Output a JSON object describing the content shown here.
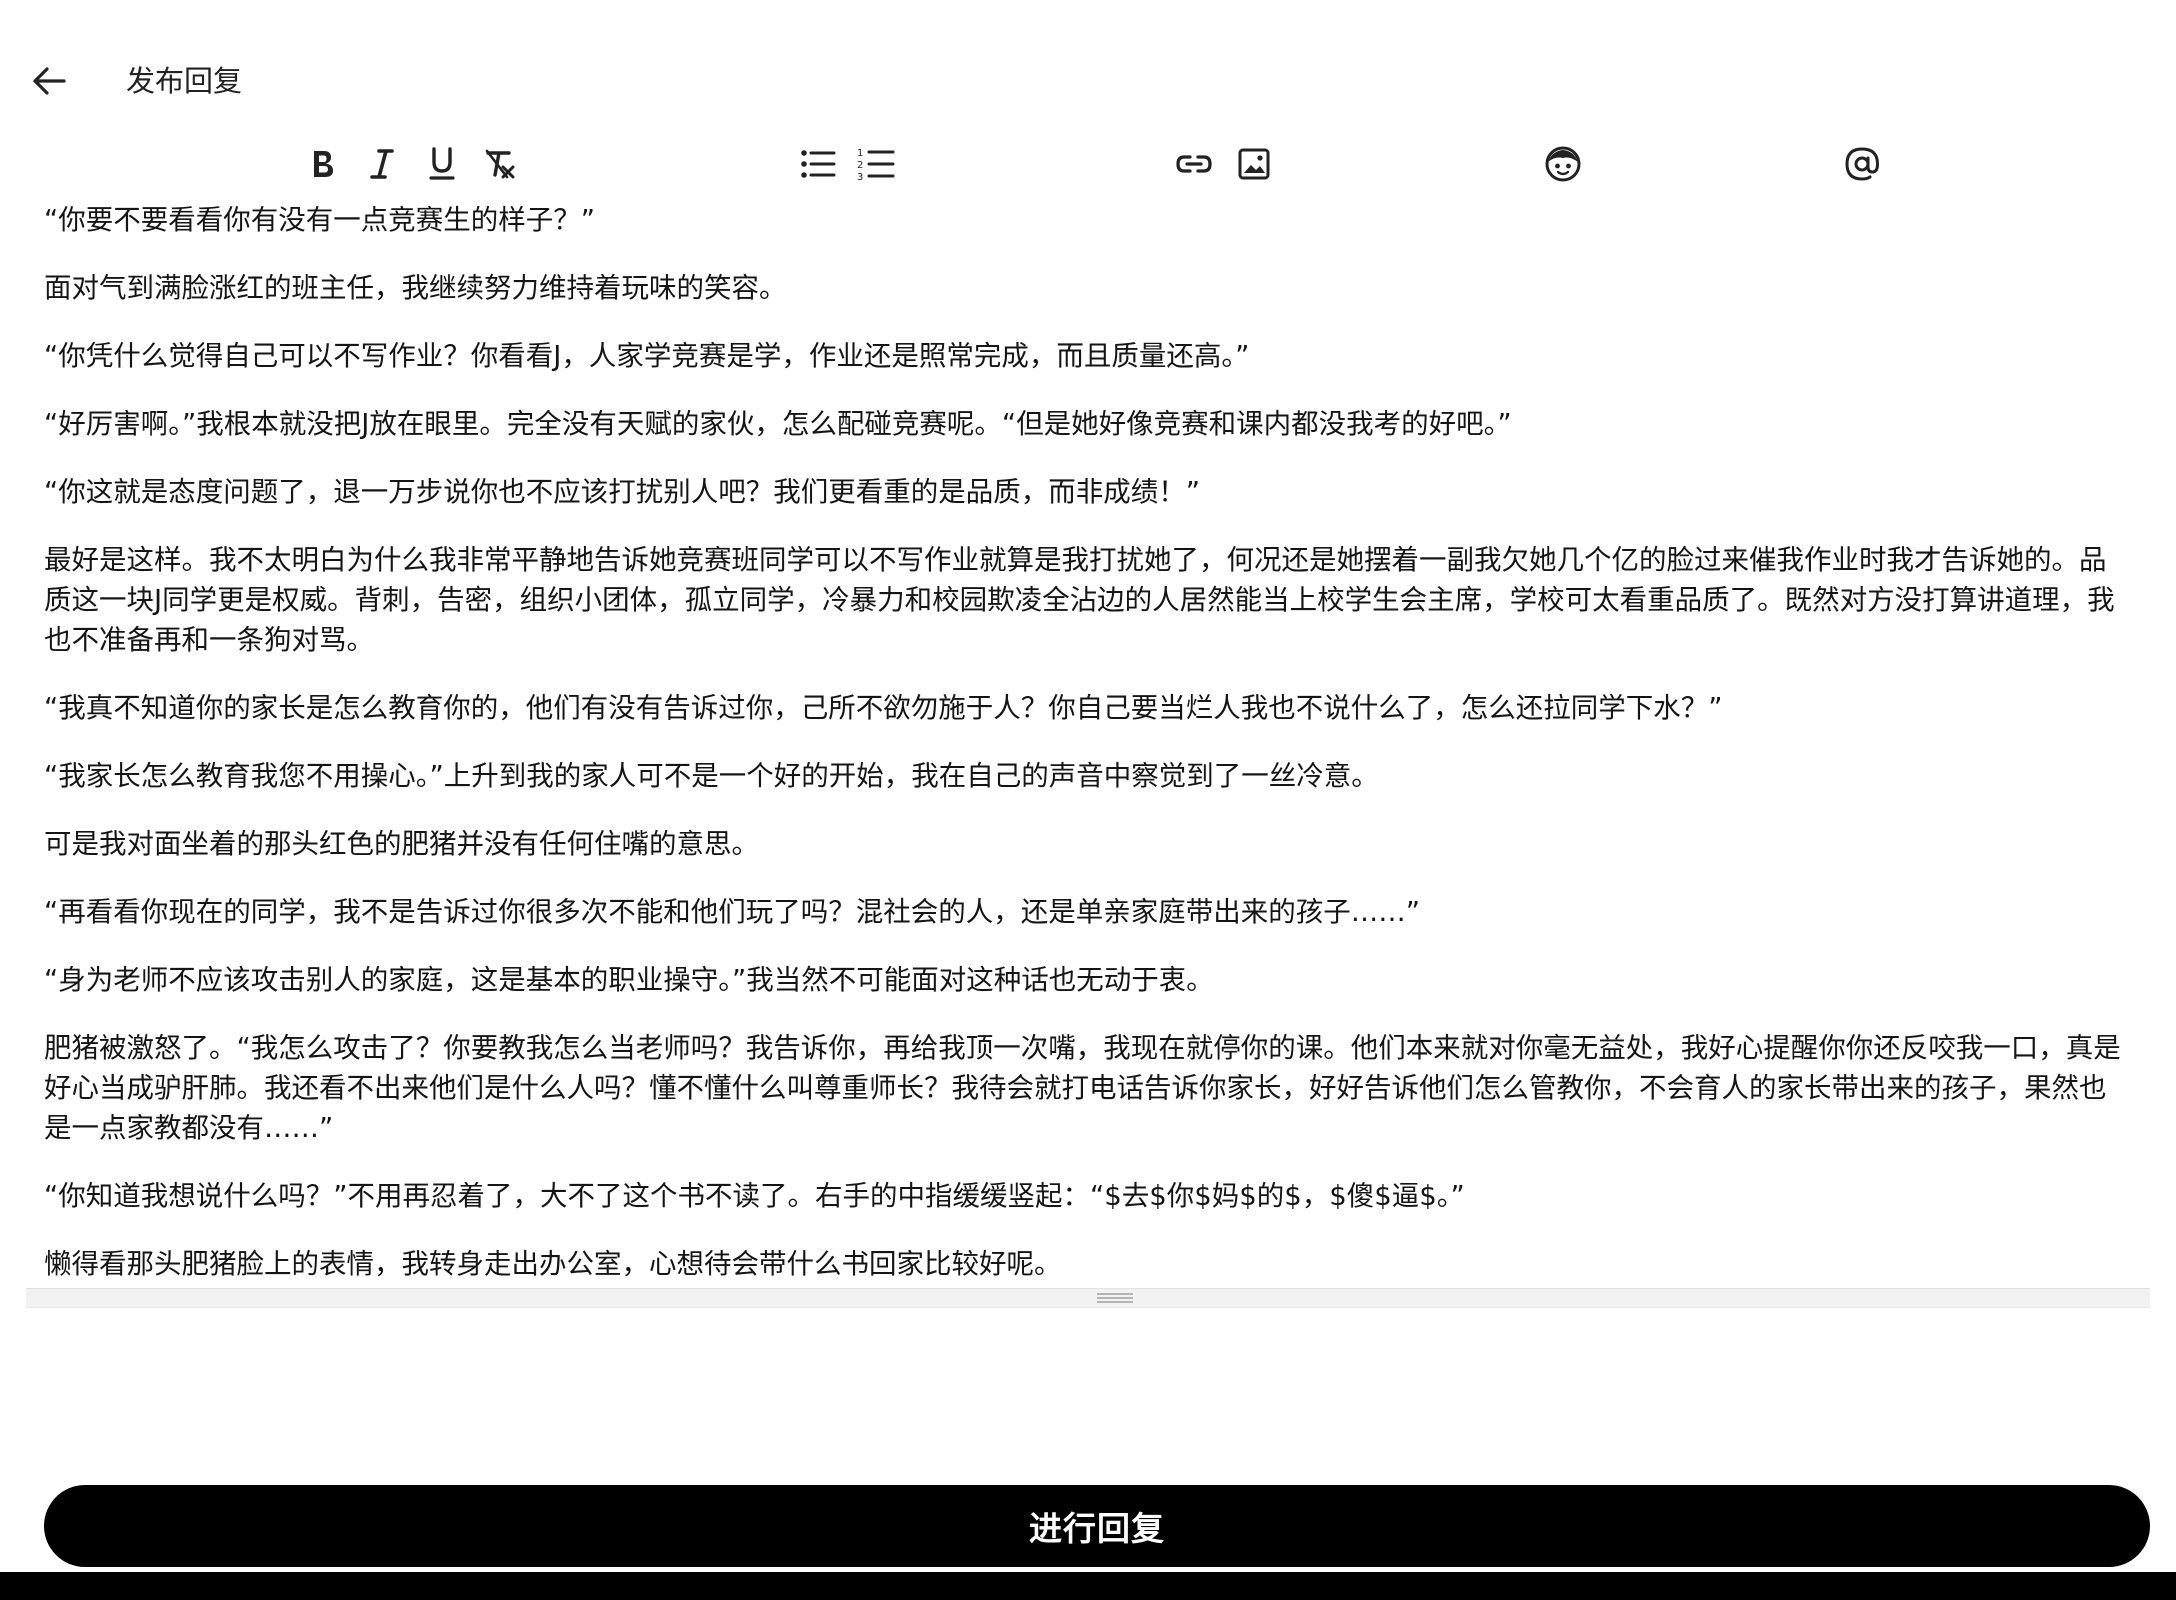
{
  "header": {
    "title": "发布回复",
    "back_icon": "arrow-left-icon"
  },
  "toolbar": {
    "items": [
      {
        "name": "bold",
        "icon": "bold-icon"
      },
      {
        "name": "italic",
        "icon": "italic-icon"
      },
      {
        "name": "underline",
        "icon": "underline-icon"
      },
      {
        "name": "clear-format",
        "icon": "clear-format-icon"
      },
      {
        "name": "bullet-list",
        "icon": "bullet-list-icon"
      },
      {
        "name": "numbered-list",
        "icon": "numbered-list-icon"
      },
      {
        "name": "link",
        "icon": "link-icon"
      },
      {
        "name": "image",
        "icon": "image-icon"
      },
      {
        "name": "emoji",
        "icon": "emoji-icon"
      },
      {
        "name": "mention",
        "icon": "at-sign-icon"
      }
    ]
  },
  "editor": {
    "paragraphs": [
      "“你要不要看看你有没有一点竞赛生的样子？”",
      "面对气到满脸涨红的班主任，我继续努力维持着玩味的笑容。",
      "“你凭什么觉得自己可以不写作业？你看看J，人家学竞赛是学，作业还是照常完成，而且质量还高。”",
      "“好厉害啊。”我根本就没把J放在眼里。完全没有天赋的家伙，怎么配碰竞赛呢。“但是她好像竞赛和课内都没我考的好吧。”",
      "“你这就是态度问题了，退一万步说你也不应该打扰别人吧？我们更看重的是品质，而非成绩！”",
      "最好是这样。我不太明白为什么我非常平静地告诉她竞赛班同学可以不写作业就算是我打扰她了，何况还是她摆着一副我欠她几个亿的脸过来催我作业时我才告诉她的。品质这一块J同学更是权威。背刺，告密，组织小团体，孤立同学，冷暴力和校园欺凌全沾边的人居然能当上校学生会主席，学校可太看重品质了。既然对方没打算讲道理，我也不准备再和一条狗对骂。",
      "“我真不知道你的家长是怎么教育你的，他们有没有告诉过你，己所不欲勿施于人？你自己要当烂人我也不说什么了，怎么还拉同学下水？”",
      "“我家长怎么教育我您不用操心。”上升到我的家人可不是一个好的开始，我在自己的声音中察觉到了一丝冷意。",
      "可是我对面坐着的那头红色的肥猪并没有任何住嘴的意思。",
      "“再看看你现在的同学，我不是告诉过你很多次不能和他们玩了吗？混社会的人，还是单亲家庭带出来的孩子……”",
      "“身为老师不应该攻击别人的家庭，这是基本的职业操守。”我当然不可能面对这种话也无动于衷。",
      "肥猪被激怒了。“我怎么攻击了？你要教我怎么当老师吗？我告诉你，再给我顶一次嘴，我现在就停你的课。他们本来就对你毫无益处，我好心提醒你你还反咬我一口，真是好心当成驴肝肺。我还看不出来他们是什么人吗？懂不懂什么叫尊重师长？我待会就打电话告诉你家长，好好告诉他们怎么管教你，不会育人的家长带出来的孩子，果然也是一点家教都没有……”",
      "“你知道我想说什么吗？”不用再忍着了，大不了这个书不读了。右手的中指缓缓竖起：“$去$你$妈$的$，$傻$逼$。”",
      "懒得看那头肥猪脸上的表情，我转身走出办公室，心想待会带什么书回家比较好呢。"
    ]
  },
  "submit": {
    "label": "进行回复"
  }
}
